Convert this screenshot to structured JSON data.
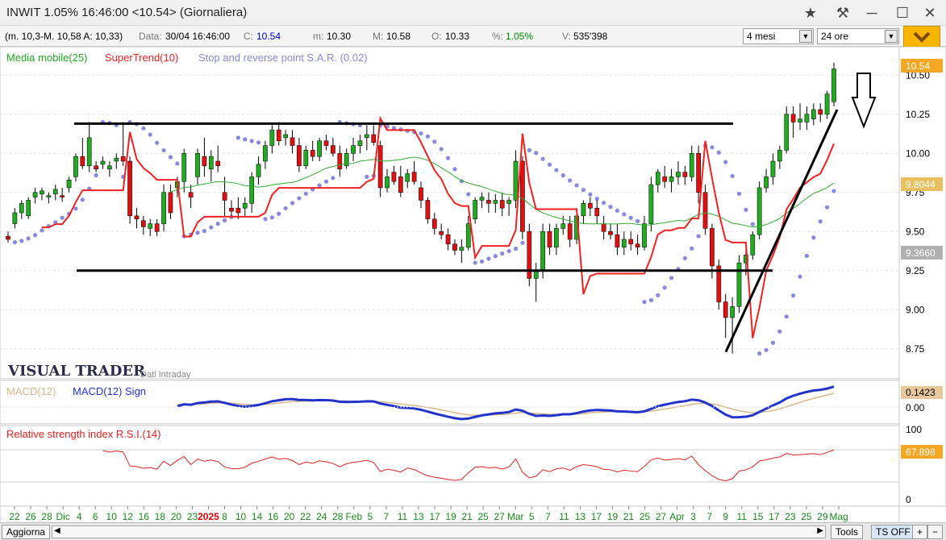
{
  "window": {
    "title": "INWIT 1.05% 16:46:00  <10.54>  (Giornaliera)",
    "icons": [
      "star-icon",
      "hammer-icon",
      "minimize-icon",
      "maximize-icon",
      "close-icon"
    ]
  },
  "infobar": {
    "range": "(m. 10,3-M. 10,58 A: 10,33)",
    "data_label": "Data:",
    "data_value": "30/04 16:46:00",
    "c_label": "C:",
    "c_value": "10.54",
    "m_label": "m:",
    "m_value": "10.30",
    "M_label": "M:",
    "M_value": "10.58",
    "o_label": "O:",
    "o_value": "10.33",
    "pct_label": "%:",
    "pct_value": "1.05%",
    "v_label": "V:",
    "v_value": "535'398",
    "period_select": "4 mesi",
    "interval_select": "24 ore"
  },
  "legend": {
    "ma": "Media mobile(25)",
    "supertrend": "SuperTrend(10)",
    "sar": "Stop and reverse point S.A.R. (0.02)",
    "brand": "VISUAL TRADER",
    "brand_sub": "Dati Intraday",
    "macd": "MACD(12)",
    "macd_sign": "MACD(12) Sign",
    "rsi": "Relative strength index R.S.I.(14)"
  },
  "price_axis": {
    "ticks": [
      "10.50",
      "10.25",
      "10.00",
      "9.75",
      "9.50",
      "9.25",
      "9.00",
      "8.75"
    ],
    "last_price": "10.54",
    "ma_value": "9.8044",
    "sar_value": "9.3660"
  },
  "macd_axis": {
    "value": "0.1423",
    "zero": "0.00"
  },
  "rsi_axis": {
    "top": "100",
    "value": "67.898",
    "bottom": "0"
  },
  "x_axis": {
    "labels": [
      "22",
      "26",
      "28",
      "Dic",
      "4",
      "6",
      "10",
      "12",
      "16",
      "18",
      "20",
      "23",
      "2025",
      "8",
      "10",
      "14",
      "16",
      "20",
      "22",
      "24",
      "28",
      "Feb",
      "5",
      "7",
      "11",
      "13",
      "17",
      "19",
      "21",
      "25",
      "27",
      "Mar",
      "5",
      "7",
      "11",
      "13",
      "17",
      "19",
      "21",
      "25",
      "27",
      "Apr",
      "3",
      "7",
      "9",
      "11",
      "15",
      "17",
      "23",
      "25",
      "29",
      "Mag"
    ]
  },
  "bottombar": {
    "refresh": "Aggiorna",
    "tools": "Tools",
    "tsoff": "TS OFF",
    "plus": "+",
    "minus": "−"
  },
  "colors": {
    "up": "#22aa22",
    "down": "#dd1111",
    "supertrend": "#ee2222",
    "ma": "#33aa33",
    "sar": "#8888dd",
    "macd": "#2233cc",
    "macd_signal": "#d8b78a",
    "rsi": "#dd2222",
    "last_price_box": "#f5a623",
    "ma_box": "#e8c060",
    "sar_box": "#b0b0b0"
  },
  "chart_data": {
    "type": "candlestick",
    "y_range": [
      8.62,
      10.62
    ],
    "candles": [
      [
        9.47,
        9.5,
        9.43,
        9.45
      ],
      [
        9.55,
        9.65,
        9.52,
        9.62
      ],
      [
        9.62,
        9.7,
        9.58,
        9.68
      ],
      [
        9.6,
        9.72,
        9.58,
        9.7
      ],
      [
        9.72,
        9.78,
        9.68,
        9.75
      ],
      [
        9.74,
        9.78,
        9.7,
        9.76
      ],
      [
        9.72,
        9.75,
        9.68,
        9.73
      ],
      [
        9.74,
        9.8,
        9.7,
        9.77
      ],
      [
        9.73,
        9.78,
        9.69,
        9.72
      ],
      [
        9.78,
        9.85,
        9.75,
        9.83
      ],
      [
        9.85,
        10.0,
        9.82,
        9.98
      ],
      [
        9.98,
        10.1,
        9.9,
        9.92
      ],
      [
        9.92,
        10.2,
        9.88,
        10.1
      ],
      [
        9.92,
        9.95,
        9.88,
        9.9
      ],
      [
        9.93,
        9.98,
        9.9,
        9.95
      ],
      [
        9.9,
        9.95,
        9.85,
        9.92
      ],
      [
        9.95,
        10.0,
        9.9,
        9.97
      ],
      [
        9.98,
        10.2,
        9.92,
        9.95
      ],
      [
        9.95,
        9.98,
        9.55,
        9.6
      ],
      [
        9.6,
        9.65,
        9.52,
        9.58
      ],
      [
        9.57,
        9.6,
        9.48,
        9.53
      ],
      [
        9.52,
        9.58,
        9.47,
        9.55
      ],
      [
        9.55,
        9.58,
        9.47,
        9.5
      ],
      [
        9.55,
        9.8,
        9.5,
        9.75
      ],
      [
        9.75,
        9.8,
        9.58,
        9.62
      ],
      [
        9.78,
        9.85,
        9.72,
        9.82
      ],
      [
        9.82,
        10.03,
        9.75,
        10.0
      ],
      [
        9.75,
        9.8,
        9.65,
        9.72
      ],
      [
        9.85,
        10.03,
        9.8,
        10.0
      ],
      [
        9.98,
        10.1,
        9.85,
        9.92
      ],
      [
        9.9,
        10.02,
        9.82,
        9.98
      ],
      [
        9.95,
        10.05,
        9.88,
        9.92
      ],
      [
        9.75,
        9.85,
        9.6,
        9.7
      ],
      [
        9.65,
        9.7,
        9.6,
        9.63
      ],
      [
        9.65,
        9.72,
        9.58,
        9.62
      ],
      [
        9.65,
        9.72,
        9.6,
        9.68
      ],
      [
        9.68,
        9.88,
        9.62,
        9.85
      ],
      [
        9.85,
        9.98,
        9.8,
        9.93
      ],
      [
        9.95,
        10.08,
        9.9,
        10.05
      ],
      [
        10.05,
        10.18,
        10.0,
        10.15
      ],
      [
        10.15,
        10.2,
        10.05,
        10.08
      ],
      [
        10.1,
        10.15,
        10.05,
        10.12
      ],
      [
        10.1,
        10.15,
        10.0,
        10.05
      ],
      [
        10.05,
        10.1,
        9.88,
        9.92
      ],
      [
        9.92,
        10.05,
        9.9,
        10.02
      ],
      [
        10.02,
        10.08,
        9.95,
        9.98
      ],
      [
        9.98,
        10.1,
        9.95,
        10.08
      ],
      [
        10.08,
        10.12,
        10.02,
        10.05
      ],
      [
        10.05,
        10.1,
        9.98,
        10.0
      ],
      [
        10.0,
        10.05,
        9.85,
        9.9
      ],
      [
        9.92,
        10.03,
        9.9,
        10.0
      ],
      [
        10.0,
        10.1,
        9.95,
        10.05
      ],
      [
        10.05,
        10.12,
        10.0,
        10.08
      ],
      [
        10.1,
        10.18,
        10.02,
        10.12
      ],
      [
        10.12,
        10.18,
        10.05,
        10.07
      ],
      [
        10.05,
        10.08,
        9.72,
        9.78
      ],
      [
        9.78,
        9.9,
        9.75,
        9.85
      ],
      [
        9.88,
        9.92,
        9.8,
        9.82
      ],
      [
        9.85,
        9.92,
        9.72,
        9.75
      ],
      [
        9.82,
        9.9,
        9.78,
        9.87
      ],
      [
        9.88,
        9.95,
        9.8,
        9.82
      ],
      [
        9.78,
        9.82,
        9.65,
        9.7
      ],
      [
        9.7,
        9.72,
        9.55,
        9.58
      ],
      [
        9.58,
        9.62,
        9.48,
        9.52
      ],
      [
        9.5,
        9.55,
        9.45,
        9.48
      ],
      [
        9.48,
        9.52,
        9.38,
        9.42
      ],
      [
        9.42,
        9.45,
        9.35,
        9.38
      ],
      [
        9.38,
        9.45,
        9.3,
        9.4
      ],
      [
        9.4,
        9.6,
        9.38,
        9.55
      ],
      [
        9.58,
        9.72,
        9.55,
        9.7
      ],
      [
        9.7,
        9.75,
        9.65,
        9.72
      ],
      [
        9.7,
        9.75,
        9.62,
        9.68
      ],
      [
        9.68,
        9.74,
        9.62,
        9.7
      ],
      [
        9.7,
        9.75,
        9.6,
        9.65
      ],
      [
        9.68,
        9.72,
        9.6,
        9.7
      ],
      [
        9.7,
        10.02,
        9.65,
        9.95
      ],
      [
        9.95,
        9.98,
        9.45,
        9.5
      ],
      [
        9.5,
        9.55,
        9.15,
        9.2
      ],
      [
        9.2,
        9.3,
        9.05,
        9.25
      ],
      [
        9.25,
        9.55,
        9.2,
        9.5
      ],
      [
        9.5,
        9.55,
        9.35,
        9.4
      ],
      [
        9.4,
        9.55,
        9.35,
        9.52
      ],
      [
        9.52,
        9.6,
        9.48,
        9.55
      ],
      [
        9.55,
        9.6,
        9.4,
        9.45
      ],
      [
        9.45,
        9.65,
        9.42,
        9.6
      ],
      [
        9.6,
        9.7,
        9.55,
        9.68
      ],
      [
        9.68,
        9.72,
        9.6,
        9.65
      ],
      [
        9.65,
        9.7,
        9.55,
        9.6
      ],
      [
        9.55,
        9.6,
        9.45,
        9.5
      ],
      [
        9.5,
        9.55,
        9.45,
        9.48
      ],
      [
        9.48,
        9.55,
        9.35,
        9.4
      ],
      [
        9.4,
        9.5,
        9.35,
        9.45
      ],
      [
        9.45,
        9.5,
        9.38,
        9.42
      ],
      [
        9.42,
        9.48,
        9.35,
        9.4
      ],
      [
        9.4,
        9.6,
        9.38,
        9.55
      ],
      [
        9.55,
        9.85,
        9.5,
        9.8
      ],
      [
        9.8,
        9.9,
        9.75,
        9.88
      ],
      [
        9.85,
        9.92,
        9.78,
        9.82
      ],
      [
        9.82,
        9.9,
        9.75,
        9.85
      ],
      [
        9.85,
        9.95,
        9.8,
        9.88
      ],
      [
        9.88,
        9.92,
        9.8,
        9.85
      ],
      [
        9.85,
        10.05,
        9.82,
        10.0
      ],
      [
        10.0,
        10.05,
        9.68,
        9.75
      ],
      [
        9.75,
        9.8,
        9.48,
        9.52
      ],
      [
        9.52,
        9.55,
        9.2,
        9.28
      ],
      [
        9.28,
        9.32,
        9.0,
        9.05
      ],
      [
        9.05,
        9.1,
        8.82,
        8.95
      ],
      [
        8.95,
        9.08,
        8.72,
        9.02
      ],
      [
        9.02,
        9.35,
        8.98,
        9.3
      ],
      [
        9.3,
        9.4,
        9.22,
        9.35
      ],
      [
        9.35,
        9.5,
        9.32,
        9.48
      ],
      [
        9.48,
        9.82,
        9.45,
        9.78
      ],
      [
        9.78,
        9.9,
        9.75,
        9.85
      ],
      [
        9.85,
        10.0,
        9.8,
        9.95
      ],
      [
        9.95,
        10.05,
        9.9,
        10.02
      ],
      [
        10.02,
        10.3,
        10.0,
        10.25
      ],
      [
        10.25,
        10.3,
        10.1,
        10.2
      ],
      [
        10.2,
        10.32,
        10.15,
        10.22
      ],
      [
        10.2,
        10.3,
        10.15,
        10.25
      ],
      [
        10.22,
        10.32,
        10.18,
        10.28
      ],
      [
        10.28,
        10.32,
        10.2,
        10.25
      ],
      [
        10.25,
        10.4,
        10.22,
        10.38
      ],
      [
        10.33,
        10.58,
        10.3,
        10.54
      ]
    ],
    "horizontal_lines": [
      10.19,
      9.25
    ],
    "trendline": [
      [
        8.73,
        10.28
      ]
    ],
    "macd_range": [
      -0.25,
      0.25
    ],
    "rsi_range": [
      0,
      100
    ]
  }
}
